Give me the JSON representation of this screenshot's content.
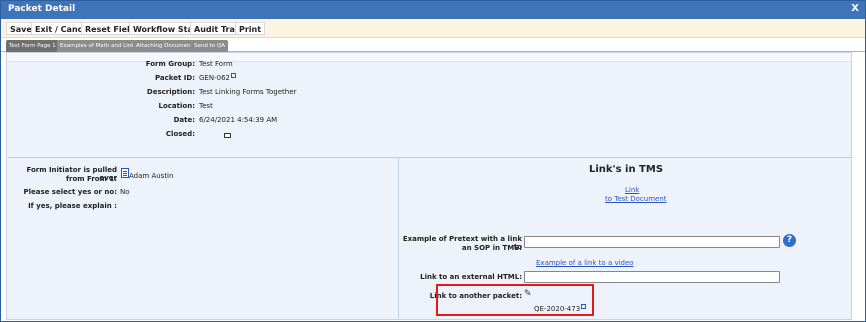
{
  "window": {
    "title": "Packet Detail",
    "close_label": "X"
  },
  "toolbar": {
    "buttons": [
      "Save",
      "Exit / Cancel",
      "Reset Fields",
      "Workflow Status",
      "Audit Trail",
      "Print"
    ]
  },
  "tabs": [
    "Test Form Page 1",
    "Examples of Math and Links",
    "Attaching Document",
    "Send to QA"
  ],
  "header": {
    "form_group": {
      "label": "Form Group:",
      "value": "Test Form"
    },
    "packet_id": {
      "label": "Packet ID:",
      "value": "GEN-062"
    },
    "description": {
      "label": "Description:",
      "value": "Test Linking Forms Together"
    },
    "location": {
      "label": "Location:",
      "value": "Test"
    },
    "date": {
      "label": "Date:",
      "value": "6/24/2021 4:54:39 AM"
    },
    "closed": {
      "label": "Closed:"
    }
  },
  "left": {
    "initiator": {
      "label_line1": "Form Initiator is pulled over",
      "label_line2": "from From 1:",
      "value": "Adam Austin"
    },
    "yes_no": {
      "label": "Please select yes or no:",
      "value": "No"
    },
    "explain": {
      "label": "If yes, please explain :"
    }
  },
  "right": {
    "title": "Link's in TMS",
    "link_line1": "Link",
    "link_line2": "to Test Document",
    "pretext": {
      "label_line1": "Example of Pretext with a link to",
      "label_line2": "an SOP in TMS:",
      "value": ""
    },
    "video_link": "Example of a link to a video",
    "external": {
      "label": "Link to an external HTML:",
      "value": ""
    },
    "another": {
      "label": "Link to another packet:",
      "value": "QE-2020-473"
    }
  },
  "colors": {
    "titlebar": "#3f74b9",
    "toolbar": "#fdf3e1",
    "content": "#eef3fb",
    "link": "#2b55c3",
    "highlight": "#e01a1a"
  },
  "icons": {
    "packet_link": "external-link-icon",
    "document": "document-icon",
    "help": "help-icon",
    "edit": "pencil-icon"
  }
}
